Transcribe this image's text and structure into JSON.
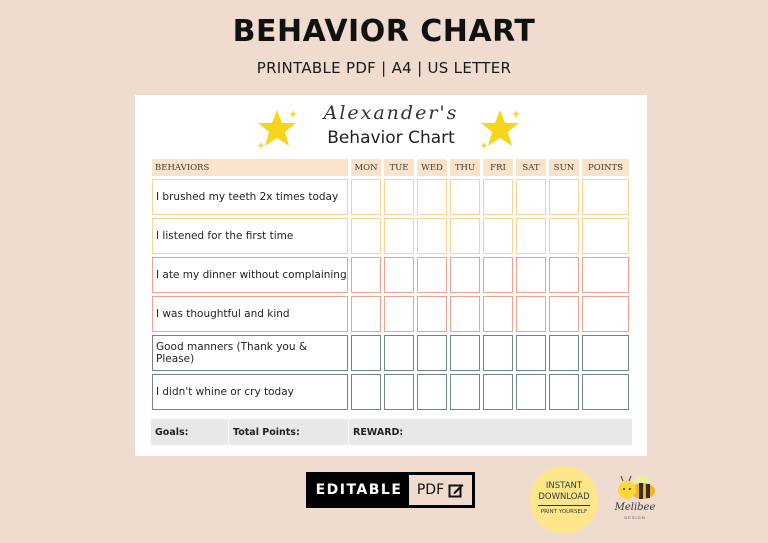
{
  "header": {
    "title": "BEHAVIOR CHART",
    "subtitle": "PRINTABLE PDF | A4 | US LETTER"
  },
  "sheet": {
    "kid_name": "Alexander's",
    "title": "Behavior Chart",
    "columns": [
      "BEHAVIORS",
      "MON",
      "TUE",
      "WED",
      "THU",
      "FRI",
      "SAT",
      "SUN",
      "POINTS"
    ],
    "rows": [
      {
        "label": "I brushed my teeth 2x times today",
        "color": "#f4d596"
      },
      {
        "label": "I listened for the first time",
        "color": "#f4d596"
      },
      {
        "label": "I ate my dinner without complaining",
        "color": "#e8a596"
      },
      {
        "label": "I was thoughtful and kind",
        "color": "#e8a596"
      },
      {
        "label": "Good manners (Thank you &  Please)",
        "color": "#6e8589"
      },
      {
        "label": "I didn't whine or cry today",
        "color": "#6e8589"
      }
    ],
    "footer": {
      "goals": "Goals:",
      "total_points": "Total Points:",
      "reward": "REWARD:"
    },
    "icons": [
      "star-icon",
      "star-icon"
    ]
  },
  "badges": {
    "editable": "EDITABLE",
    "pdf": "PDF",
    "pdf_icon": "edit-icon",
    "instant_line1": "INSTANT",
    "instant_line2": "DOWNLOAD",
    "instant_line3": "PRINT YOURSELF",
    "brand": "Melibee",
    "brand_sub": "DESIGN",
    "brand_icon": "bee-icon"
  },
  "colors": {
    "background": "#efdccf",
    "header_fill": "#fbe2cb",
    "yellow": "#f4d596",
    "salmon": "#e8a596",
    "slate": "#6e8589",
    "star": "#f7d51d",
    "instant_circle": "#fde58a"
  }
}
